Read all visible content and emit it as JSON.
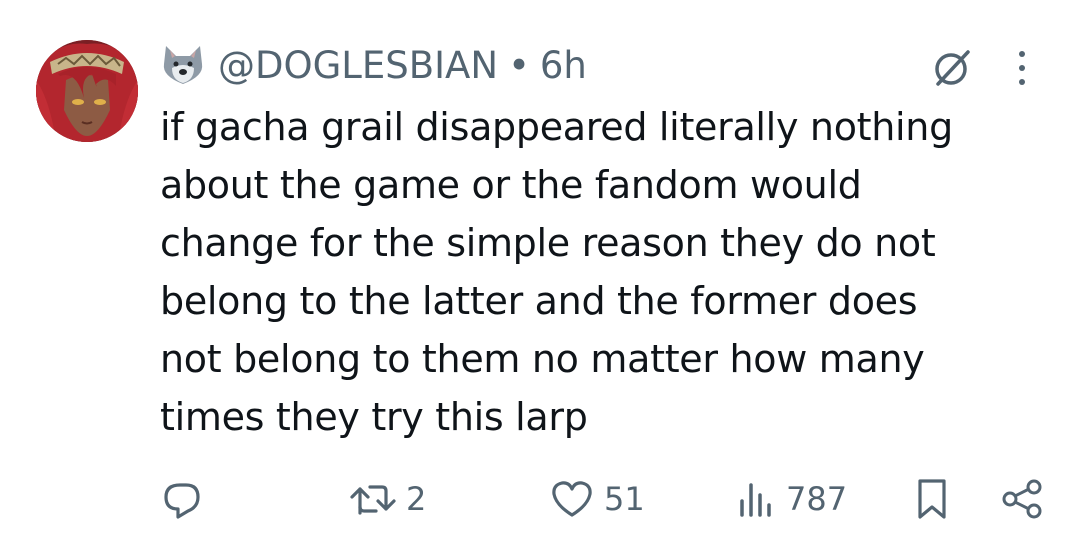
{
  "post": {
    "author_emoji": "wolf-emoji",
    "handle": "@DOGLESBIAN",
    "separator": "•",
    "time": "6h",
    "text": "if gacha grail disappeared literally nothing\nabout the game or the fandom would\nchange for the simple reason they do not\nbelong to the latter and the former does\nnot belong to them no matter how many\ntimes they try this larp"
  },
  "actions": {
    "reply_icon": "reply-icon",
    "repost_icon": "repost-icon",
    "repost_count": "2",
    "like_icon": "heart-icon",
    "like_count": "51",
    "views_icon": "views-icon",
    "views_count": "787",
    "bookmark_icon": "bookmark-icon",
    "share_icon": "share-icon"
  },
  "colors": {
    "text": "#0f1419",
    "secondary": "#536471",
    "background": "#ffffff"
  }
}
